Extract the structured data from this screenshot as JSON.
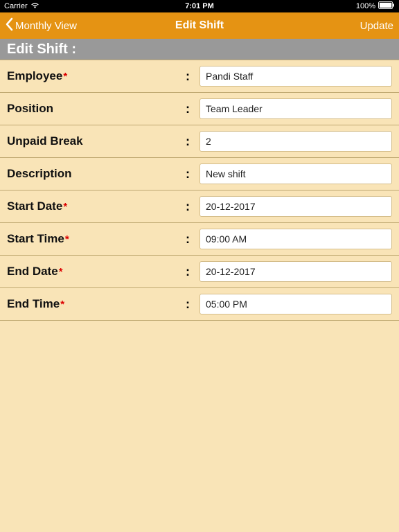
{
  "status": {
    "carrier": "Carrier",
    "time": "7:01 PM",
    "battery": "100%"
  },
  "nav": {
    "back_label": "Monthly View",
    "title": "Edit Shift",
    "action_label": "Update"
  },
  "header": {
    "title": "Edit Shift :"
  },
  "form": {
    "fields": [
      {
        "label": "Employee",
        "required": true,
        "value": "Pandi Staff"
      },
      {
        "label": "Position",
        "required": false,
        "value": "Team Leader"
      },
      {
        "label": "Unpaid Break",
        "required": false,
        "value": "2"
      },
      {
        "label": "Description",
        "required": false,
        "value": "New shift"
      },
      {
        "label": "Start Date",
        "required": true,
        "value": "20-12-2017"
      },
      {
        "label": "Start Time",
        "required": true,
        "value": "09:00 AM"
      },
      {
        "label": "End Date",
        "required": true,
        "value": "20-12-2017"
      },
      {
        "label": "End Time",
        "required": true,
        "value": "05:00 PM"
      }
    ]
  }
}
